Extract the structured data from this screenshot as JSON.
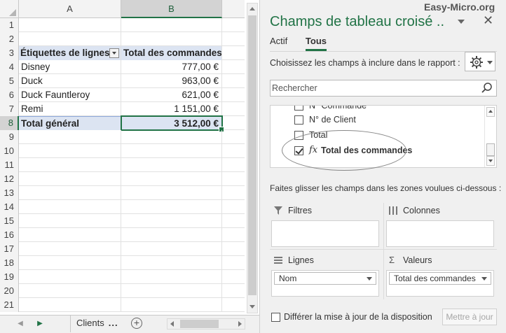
{
  "watermark": "Easy-Micro.org",
  "sheet": {
    "columns": [
      "A",
      "B"
    ],
    "row_numbers": [
      "1",
      "2",
      "3",
      "4",
      "5",
      "6",
      "7",
      "8",
      "9",
      "10",
      "11",
      "12",
      "13",
      "14",
      "15",
      "16",
      "17",
      "18",
      "19",
      "20",
      "21"
    ],
    "pivot": {
      "header": [
        "Étiquettes de lignes",
        "Total des commandes"
      ],
      "rows": [
        [
          "Disney",
          "777,00 €"
        ],
        [
          "Duck",
          "963,00 €"
        ],
        [
          "Duck Fauntleroy",
          "621,00 €"
        ],
        [
          "Remi",
          "1 151,00 €"
        ]
      ],
      "total": [
        "Total général",
        "3 512,00 €"
      ]
    },
    "tabs": {
      "sheet_name": "Clients",
      "more": "..."
    }
  },
  "pane": {
    "title": "Champs de tableau croisé ..",
    "close": "✕",
    "tabs": [
      "Actif",
      "Tous"
    ],
    "active_tab": "Tous",
    "choose_label": "Choisissez les champs à inclure dans le rapport :",
    "search_placeholder": "Rechercher",
    "fields": [
      {
        "label": "N° Commande",
        "checked": false
      },
      {
        "label": "N° de Client",
        "checked": false
      },
      {
        "label": "Total",
        "checked": false
      },
      {
        "label": "Total des commandes",
        "checked": true,
        "calculated": true
      }
    ],
    "fx": "fx",
    "drag_hint": "Faites glisser les champs dans les zones voulues ci-dessous :",
    "areas": {
      "filters": {
        "label": "Filtres",
        "items": []
      },
      "columns": {
        "label": "Colonnes",
        "items": []
      },
      "rows": {
        "label": "Lignes",
        "items": [
          "Nom"
        ]
      },
      "values": {
        "label": "Valeurs",
        "items": [
          "Total des commandes"
        ]
      }
    },
    "defer_label": "Différer la mise à jour de la disposition",
    "update_label": "Mettre à jour"
  },
  "colors": {
    "accent": "#217346",
    "pivot_header_fill": "#dce4f2"
  }
}
